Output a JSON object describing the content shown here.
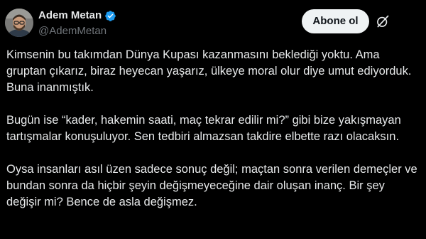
{
  "author": {
    "display_name": "Adem Metan",
    "handle": "@AdemMetan",
    "verified": true,
    "avatar_icon": "avatar-man-glasses"
  },
  "actions": {
    "follow_label": "Abone ol",
    "grok_icon": "grok-icon"
  },
  "tweet": {
    "paragraphs": [
      "Kimsenin bu takımdan Dünya Kupası kazanmasını beklediği yoktu. Ama gruptan çıkarız, biraz heyecan yaşarız, ülkeye moral olur diye umut ediyorduk. Buna inanmıştık.",
      "Bugün ise “kader, hakemin saati, maç tekrar edilir mi?” gibi bize yakışmayan tartışmalar konuşuluyor. Sen tedbiri almazsan takdire elbette razı olacaksın.",
      "Oysa insanları asıl üzen sadece sonuç değil; maçtan sonra verilen demeçler ve bundan sonra da hiçbir şeyin değişmeyeceğine dair oluşan inanç. Bir şey değişir mi? Bence de asla değişmez."
    ]
  },
  "colors": {
    "background": "#000000",
    "text": "#e7e9ea",
    "secondary_text": "#71767b",
    "verified_badge": "#1d9bf0",
    "button_bg": "#eff3f4"
  }
}
